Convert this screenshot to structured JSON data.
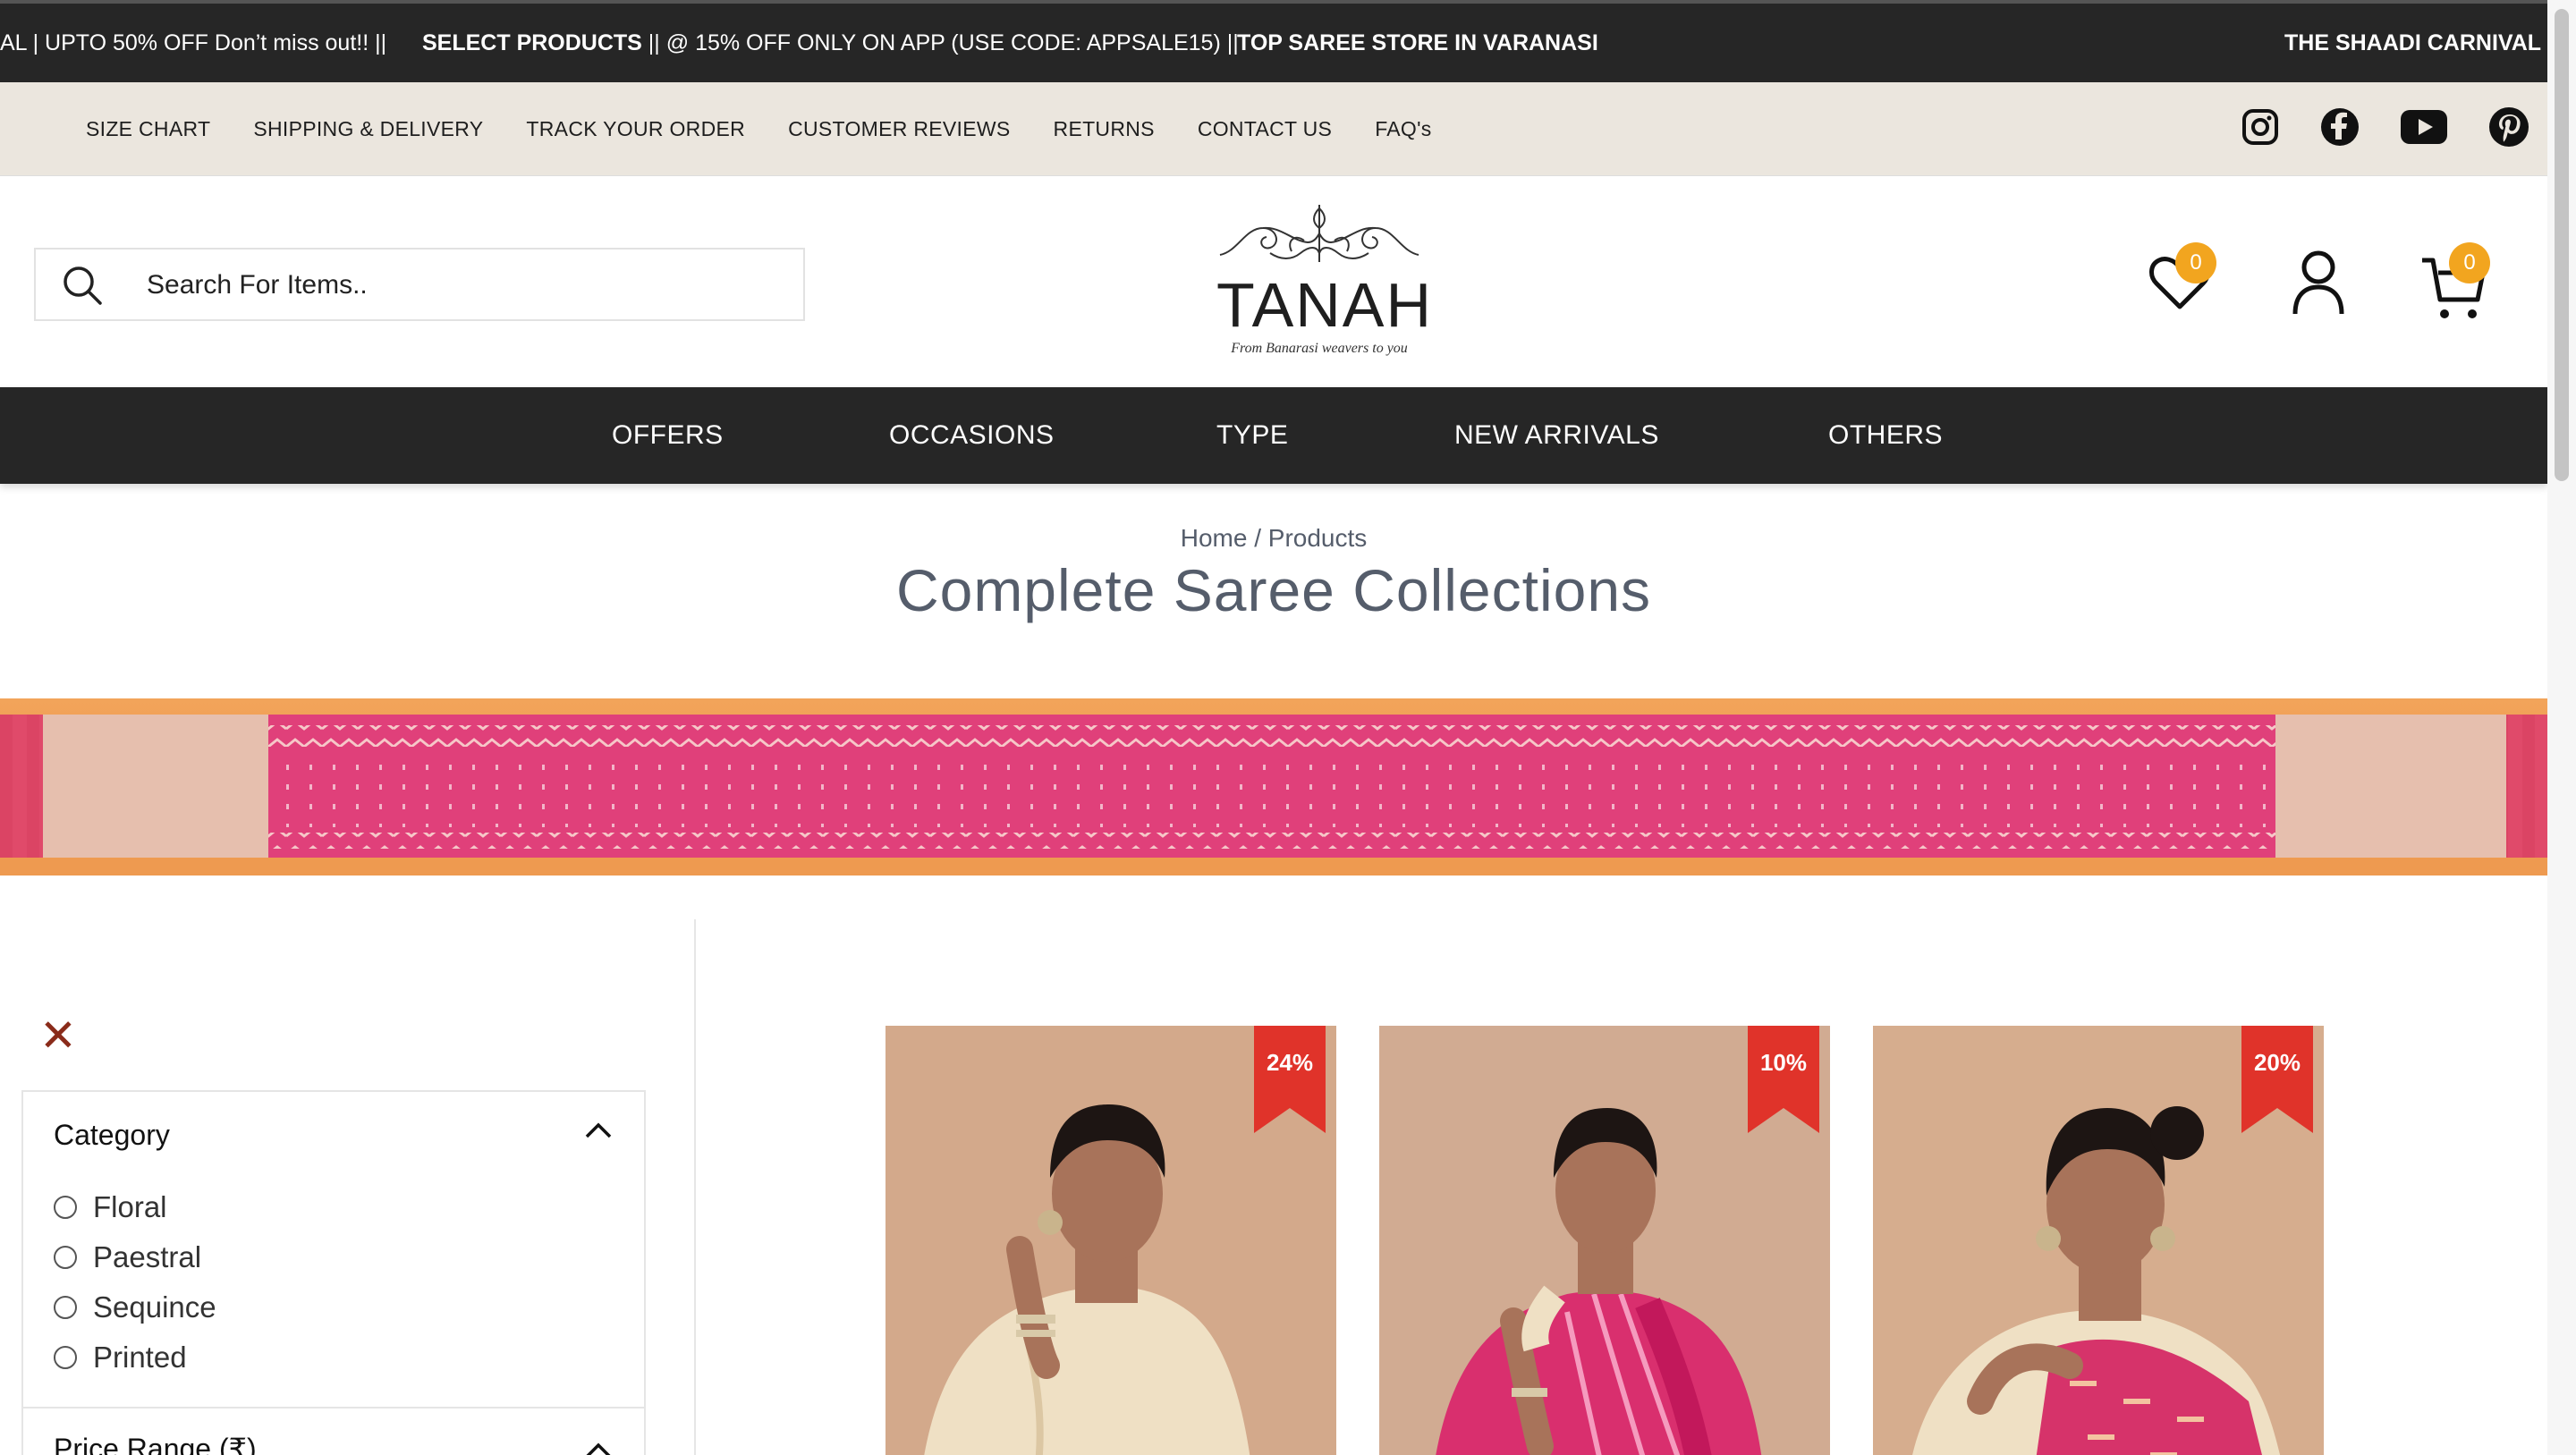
{
  "announcement": {
    "seg1": "AL | UPTO 50% OFF Don’t miss out!!  ||",
    "seg2_bold": "SELECT PRODUCTS",
    "seg2_rest": " || @ 15% OFF ONLY ON APP (USE CODE: APPSALE15)  ||",
    "seg3": "TOP SAREE STORE IN VARANASI",
    "seg4": "THE SHAADI CARNIVAL |"
  },
  "utility_links": [
    "SIZE CHART",
    "SHIPPING & DELIVERY",
    "TRACK YOUR ORDER",
    "CUSTOMER REVIEWS",
    "RETURNS",
    "CONTACT US",
    "FAQ's"
  ],
  "social": [
    "instagram-icon",
    "facebook-icon",
    "youtube-icon",
    "pinterest-icon"
  ],
  "search": {
    "placeholder": "Search For Items.."
  },
  "logo": {
    "word": "TANAH",
    "tagline": "From Banarasi weavers to you"
  },
  "header_icons": {
    "wishlist_count": "0",
    "cart_count": "0"
  },
  "main_nav": [
    "OFFERS",
    "OCCASIONS",
    "TYPE",
    "NEW ARRIVALS",
    "OTHERS"
  ],
  "breadcrumb": {
    "home": "Home",
    "sep": "/",
    "current": "Products"
  },
  "page_title": "Complete Saree Collections",
  "filters": {
    "close_symbol": "✕",
    "category_heading": "Category",
    "category_options": [
      "Floral",
      "Paestral",
      "Sequince",
      "Printed"
    ],
    "price_heading": "Price Range (₹)"
  },
  "products": [
    {
      "discount": "24%",
      "saree_color": "#efe0c4"
    },
    {
      "discount": "10%",
      "saree_color": "#d92f6e"
    },
    {
      "discount": "20%",
      "saree_color": "#d6336a"
    }
  ],
  "colors": {
    "dark_bar": "#262626",
    "utility_bg": "#ebe6de",
    "badge": "#f2a51f",
    "ribbon": "#e0332a",
    "banner_pink": "#e0407a",
    "banner_orange": "#f2a056"
  }
}
